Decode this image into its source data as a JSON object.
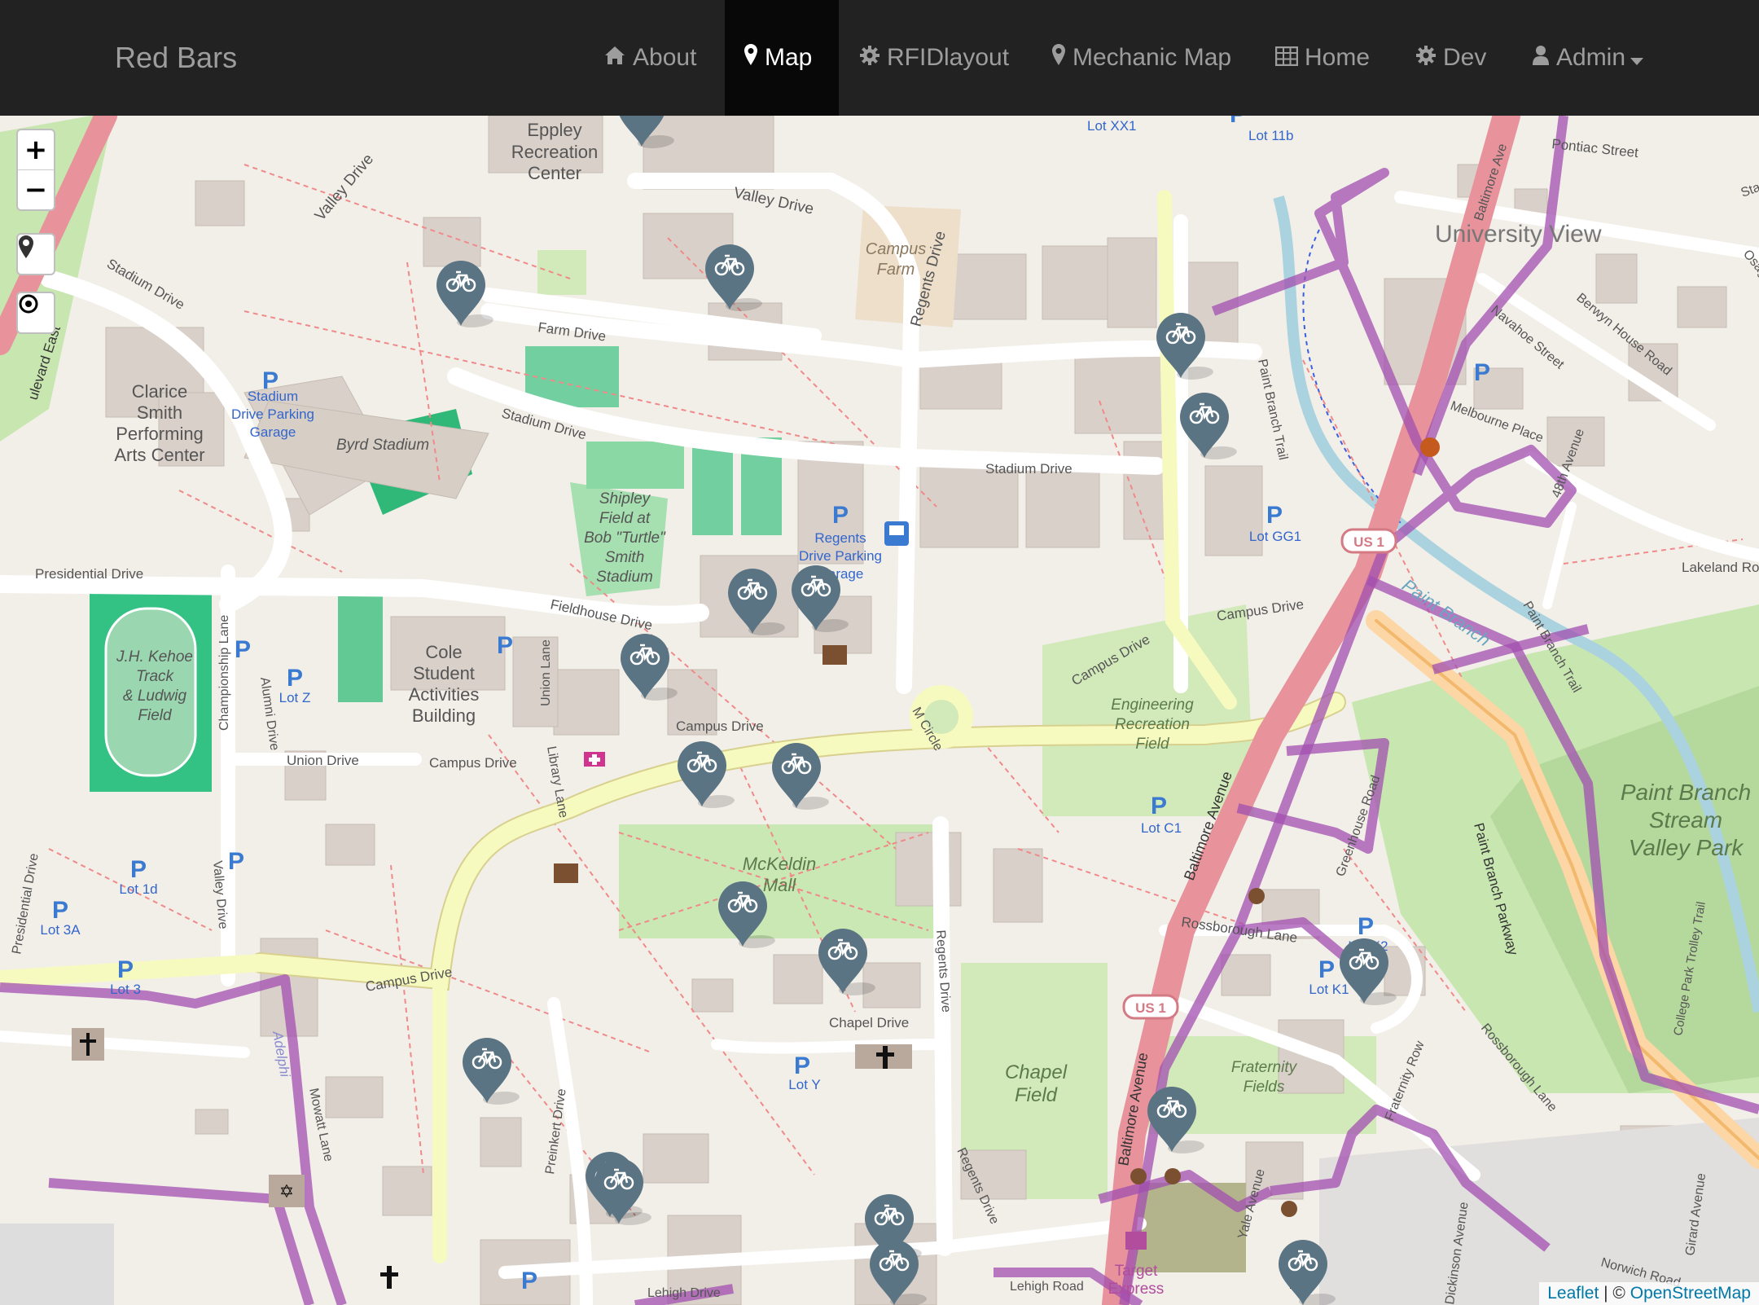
{
  "navbar": {
    "brand": "Red Bars",
    "items": [
      {
        "label": "About",
        "icon": "home-icon",
        "active": false
      },
      {
        "label": "Map",
        "icon": "map-marker-icon",
        "active": true
      },
      {
        "label": "RFIDlayout",
        "icon": "gear-icon",
        "active": false
      },
      {
        "label": "Mechanic Map",
        "icon": "map-marker-icon",
        "active": false
      },
      {
        "label": "Home",
        "icon": "table-icon",
        "active": false
      },
      {
        "label": "Dev",
        "icon": "gear-icon",
        "active": false
      },
      {
        "label": "Admin",
        "icon": "user-icon",
        "active": false,
        "dropdown": true
      }
    ]
  },
  "map_controls": {
    "zoom_in": "+",
    "zoom_out": "−",
    "locate_icon": "map-marker-icon",
    "target_icon": "crosshair-icon"
  },
  "attribution": {
    "leaflet": "Leaflet",
    "separator": " | © ",
    "osm": "OpenStreetMap"
  },
  "colors": {
    "navbar_bg": "#222222",
    "marker": "#5b7483",
    "boundary": "#a24fb0",
    "road_major": "#e8929b",
    "road_minor": "#f7fabf"
  },
  "map_labels": {
    "recreation": "Recreation",
    "center": "Center",
    "eppley": "Eppley",
    "valley_drive_1": "Valley Drive",
    "valley_drive_2": "Valley Drive",
    "campus_farm_1": "Campus",
    "campus_farm_2": "Farm",
    "regents_drive_1": "Regents Drive",
    "lot_xx1": "Lot XX1",
    "lot_11b": "Lot 11b",
    "pontiac_street": "Pontiac Street",
    "university_view": "University View",
    "stadium_drive_1": "Stadium Drive",
    "farm_drive": "Farm Drive",
    "stadium_parking_1": "Stadium",
    "stadium_parking_2": "Drive Parking",
    "stadium_parking_3": "Garage",
    "clarice_1": "Clarice",
    "clarice_2": "Smith",
    "clarice_3": "Performing",
    "clarice_4": "Arts Center",
    "byrd_stadium": "Byrd Stadium",
    "stadium_drive_2": "Stadium Drive",
    "stadium_drive_3": "Stadium Drive",
    "paint_branch_trail": "Paint Branch Trail",
    "navahoe_street": "Navahoe Street",
    "berwyn_house_road": "Berwyn House Road",
    "melbourne_place": "Melbourne Place",
    "ave_48th": "48th Avenue",
    "baltimore_ave_1": "Baltimore Ave",
    "shipley_1": "Shipley",
    "shipley_2": "Field at",
    "shipley_3": "Bob \"Turtle\"",
    "shipley_4": "Smith",
    "shipley_5": "Stadium",
    "regents_garage_1": "Regents",
    "regents_garage_2": "Drive Parking",
    "regents_garage_3": "Garage",
    "lot_gg1": "Lot GG1",
    "us1_a": "US 1",
    "lakeland_road": "Lakeland Road",
    "presidential_drive": "Presidential Drive",
    "fieldhouse_drive": "Fieldhouse Drive",
    "campus_drive_1": "Campus Drive",
    "campus_drive_2": "Campus Drive",
    "campus_drive_3": "Campus Drive",
    "campus_drive_4": "Campus Drive",
    "campus_drive_5": "Campus Drive",
    "paint_branch": "Paint Branch",
    "paint_branch_trail_2": "Paint Branch Trail",
    "kehoe_1": "J.H. Kehoe",
    "kehoe_2": "Track",
    "kehoe_3": "& Ludwig",
    "kehoe_4": "Field",
    "championship_lane": "Championship Lane",
    "alumni_drive": "Alumni Drive",
    "lot_z": "Lot Z",
    "cole_1": "Cole",
    "cole_2": "Student",
    "cole_3": "Activities",
    "cole_4": "Building",
    "union_lane": "Union Lane",
    "union_drive": "Union Drive",
    "library_lane": "Library Lane",
    "m_circle": "M Circle",
    "engineering_1": "Engineering",
    "engineering_2": "Recreation",
    "engineering_3": "Field",
    "lot_c1": "Lot C1",
    "baltimore_ave_2": "Baltimore Avenue",
    "greenhouse_road": "Greenhouse Road",
    "paint_branch_parkway": "Paint Branch Parkway",
    "pb_park_1": "Paint Branch",
    "pb_park_2": "Stream",
    "pb_park_3": "Valley Park",
    "college_park_trolley_trail": "College Park Trolley Trail",
    "lot_1d": "Lot 1d",
    "lot_3a": "Lot 3A",
    "lot_3": "Lot 3",
    "valley_drive_3": "Valley Drive",
    "presidential_drive_2": "Presidential Drive",
    "mckeldin_1": "McKeldin",
    "mckeldin_2": "Mall",
    "rossborough_lane": "Rossborough Lane",
    "lot_k2": "Lot K2",
    "lot_k1": "Lot K1",
    "regents_drive_2": "Regents Drive",
    "chapel_drive": "Chapel Drive",
    "chapel_1": "Chapel",
    "chapel_2": "Field",
    "lot_y": "Lot Y",
    "us1_b": "US 1",
    "baltimore_ave_3": "Baltimore Avenue",
    "fraternity_1": "Fraternity",
    "fraternity_2": "Fields",
    "fraternity_row": "Fraternity Row",
    "rossborough_lane_2": "Rossborough Lane",
    "adelphi": "Adelphi",
    "mowatt_lane": "Mowatt Lane",
    "preinkert_drive": "Preinkert Drive",
    "regents_drive_3": "Regents Drive",
    "yale_avenue": "Yale Avenue",
    "dickinson_avenue": "Dickinson Avenue",
    "girard_avenue": "Girard Avenue",
    "norwich_road": "Norwich Road",
    "lehigh_road": "Lehigh Road",
    "lehigh_drive": "Lehigh Drive",
    "target_1": "Target",
    "target_2": "Express",
    "ulevard_east": "ulevard East",
    "stadium_drive_4": "Stadium Drive",
    "osage": "Osage"
  },
  "parking_symbol": "P",
  "markers_count_label": "",
  "map_state": {
    "zoom_control_visible": true
  }
}
